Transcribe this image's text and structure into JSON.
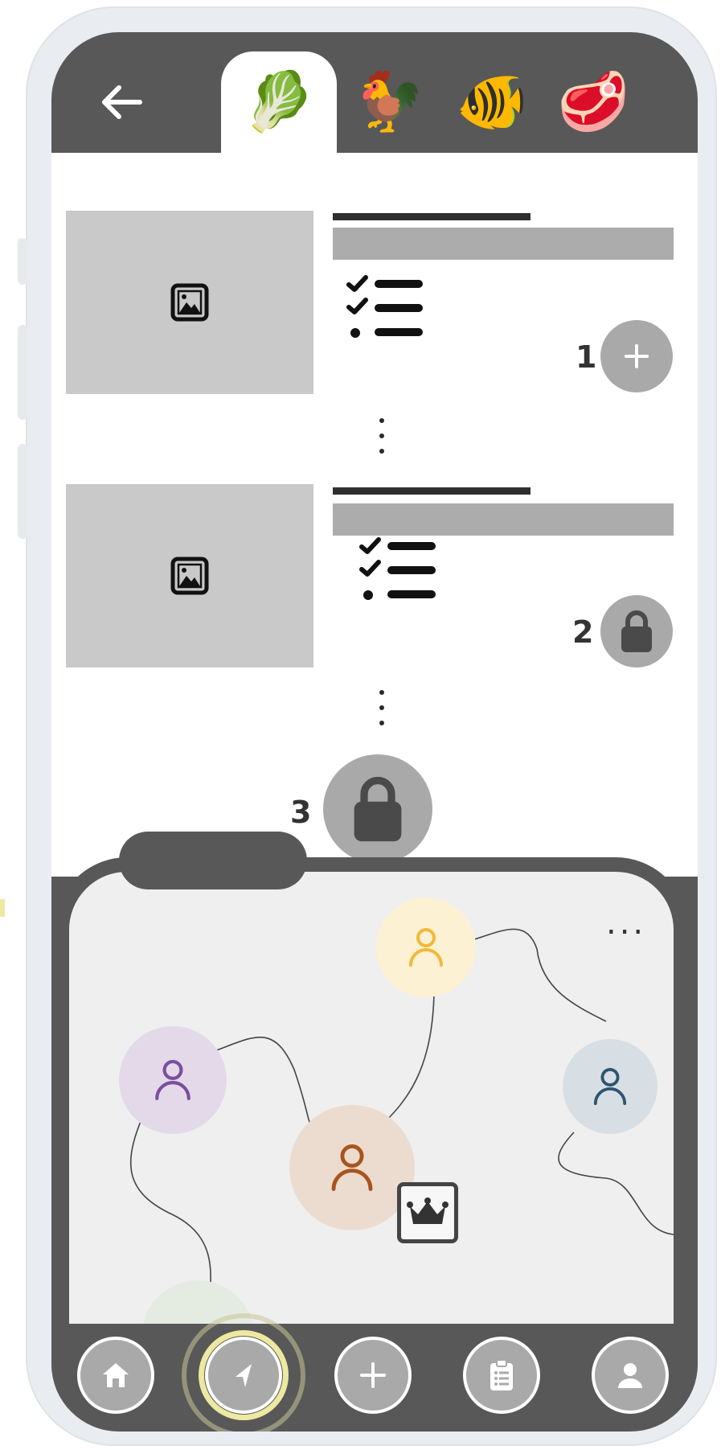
{
  "tabs": [
    {
      "name": "vegetables",
      "glyph": "🥬",
      "active": true
    },
    {
      "name": "poultry",
      "glyph": "🐓",
      "active": false
    },
    {
      "name": "fish",
      "glyph": "🐠",
      "active": false
    },
    {
      "name": "meat",
      "glyph": "🥩",
      "active": false
    }
  ],
  "levels": [
    {
      "number": "1",
      "state": "unlocked",
      "icon": "plus-icon"
    },
    {
      "number": "2",
      "state": "locked",
      "icon": "lock-icon"
    },
    {
      "number": "3",
      "state": "locked",
      "icon": "lock-icon"
    }
  ],
  "network": {
    "more_label": "...",
    "nodes": [
      {
        "name": "yellow-user",
        "color": "#fdf1d3",
        "icon_color": "#f0b93a"
      },
      {
        "name": "purple-user",
        "color": "#e4d9e8",
        "icon_color": "#7a4ea0"
      },
      {
        "name": "blue-user",
        "color": "#d7dfe5",
        "icon_color": "#2e5570"
      },
      {
        "name": "brown-user",
        "color": "#ecdcd0",
        "icon_color": "#a8541c"
      },
      {
        "name": "green-user",
        "color": "#e4ece2",
        "icon_color": "#9aa89a"
      }
    ],
    "leader_badge": "crown-icon"
  },
  "nav": [
    {
      "name": "home",
      "icon": "home-icon"
    },
    {
      "name": "navigate",
      "icon": "navigation-icon",
      "highlighted": true
    },
    {
      "name": "add",
      "icon": "plus-icon"
    },
    {
      "name": "list",
      "icon": "clipboard-icon"
    },
    {
      "name": "profile",
      "icon": "user-icon"
    }
  ],
  "colors": {
    "frame": "#585858",
    "thumb": "#c9c9c9",
    "button": "#a9a9a9",
    "highlight": "#ece9a0"
  }
}
